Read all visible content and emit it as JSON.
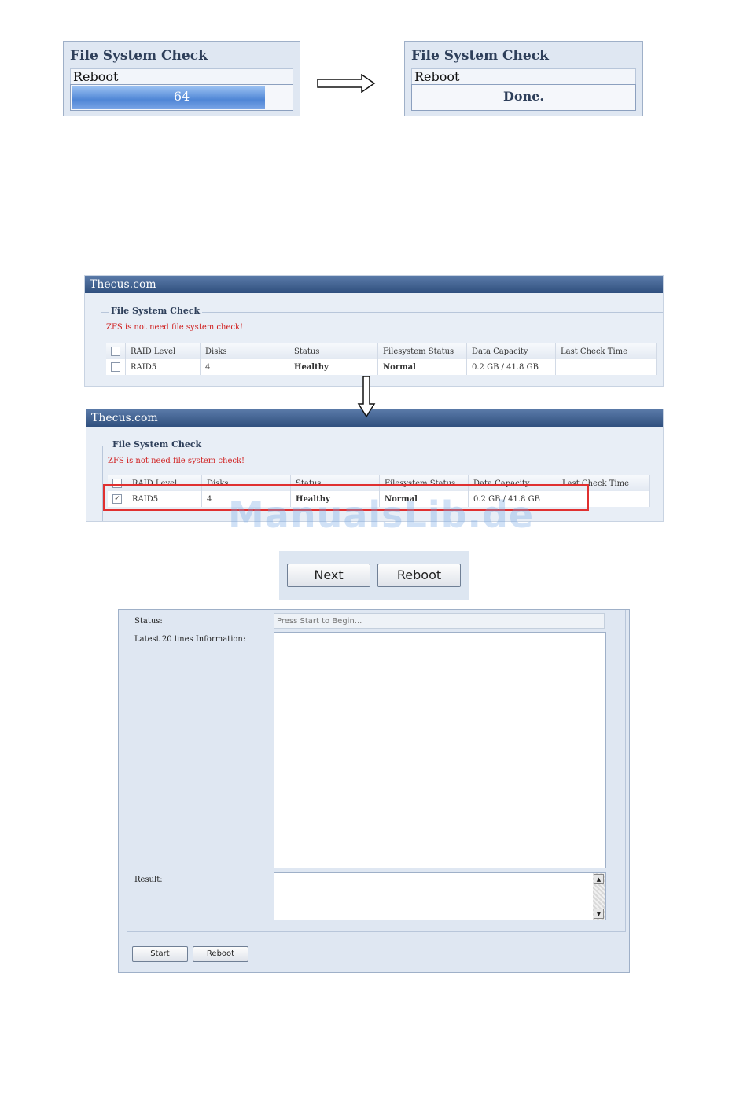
{
  "dialog_progress": {
    "title": "File System Check",
    "subtitle": "Reboot",
    "progress_label": "64",
    "progress_fraction": 0.88
  },
  "dialog_done": {
    "title": "File System Check",
    "subtitle": "Reboot",
    "status_label": "Done."
  },
  "panel1": {
    "header": "Thecus.com",
    "legend": "File System Check",
    "warning": "ZFS is not need file system check!",
    "columns": [
      "RAID Level",
      "Disks",
      "Status",
      "Filesystem Status",
      "Data Capacity",
      "Last Check Time"
    ],
    "row": {
      "raid": "RAID5",
      "disks": "4",
      "status": "Healthy",
      "fs_status": "Normal",
      "capacity": "0.2 GB / 41.8 GB",
      "last_check": ""
    }
  },
  "panel2": {
    "header": "Thecus.com",
    "legend": "File System Check",
    "warning": "ZFS is not need file system check!",
    "columns": [
      "RAID Level",
      "Disks",
      "Status",
      "Filesystem Status",
      "Data Capacity",
      "Last Check Time"
    ],
    "row": {
      "raid": "RAID5",
      "disks": "4",
      "status": "Healthy",
      "fs_status": "Normal",
      "capacity": "0.2 GB / 41.8 GB",
      "last_check": ""
    }
  },
  "nav_buttons": {
    "next": "Next",
    "reboot": "Reboot"
  },
  "check_form": {
    "status_label": "Status:",
    "status_placeholder": "Press Start to Begin...",
    "info_label": "Latest 20 lines Information:",
    "result_label": "Result:",
    "start_button": "Start",
    "reboot_button": "Reboot"
  },
  "watermark": "ManualsLib.de",
  "colors": {
    "accent": "#2f4f7e",
    "healthy": "#2a8a2a",
    "warning": "#d02020",
    "highlight": "#e03030"
  }
}
